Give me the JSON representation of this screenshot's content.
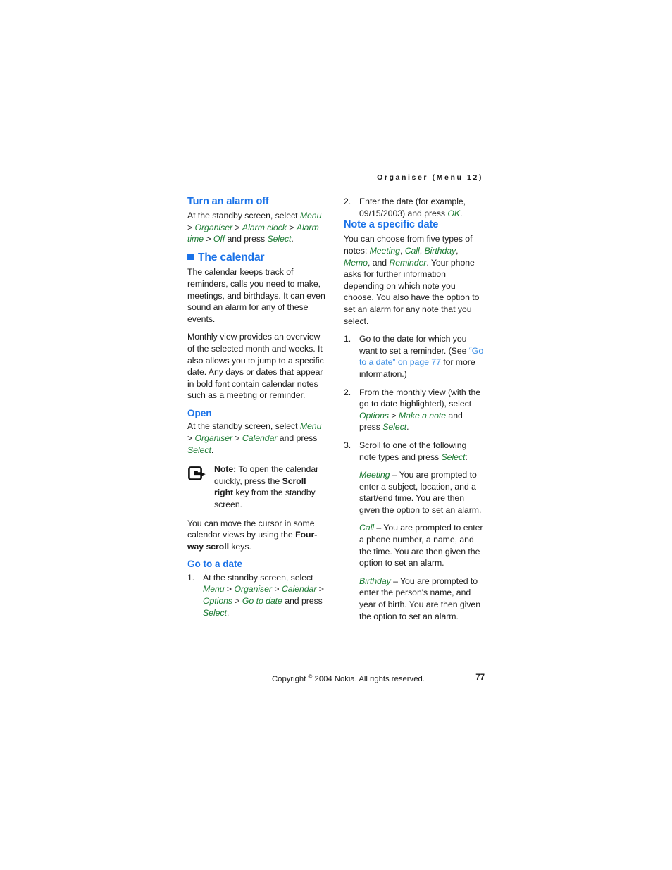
{
  "header": {
    "running_head": "Organiser (Menu 12)"
  },
  "left_column": {
    "turn_alarm_off": {
      "heading": "Turn an alarm off",
      "para_lead": "At the standby screen, select ",
      "path_menu": "Menu",
      "sep1": " > ",
      "path_organiser": "Organiser",
      "sep2": " > ",
      "path_alarm_clock": "Alarm clock",
      "sep3": " > ",
      "path_alarm_time": "Alarm time",
      "sep4": " > ",
      "path_off": "Off",
      "mid": " and press ",
      "path_select": "Select",
      "end": "."
    },
    "the_calendar": {
      "heading": "The calendar",
      "para1": "The calendar keeps track of reminders, calls you need to make, meetings, and birthdays. It can even sound an alarm for any of these events.",
      "para2": "Monthly view provides an overview of the selected month and weeks. It also allows you to jump to a specific date. Any days or dates that appear in bold font contain calendar notes such as a meeting or reminder."
    },
    "open": {
      "heading": "Open",
      "para_lead": "At the standby screen, select ",
      "path_menu": "Menu",
      "sep1": " > ",
      "path_organiser": "Organiser",
      "sep2": " > ",
      "path_calendar": "Calendar",
      "mid": " and press ",
      "path_select": "Select",
      "end": ".",
      "note_label": "Note:",
      "note_text_1": " To open the calendar quickly, press the ",
      "note_bold": "Scroll right",
      "note_text_2": " key from the standby screen.",
      "after_note_1": "You can move the cursor in some calendar views by using the ",
      "after_note_bold": "Four-way scroll",
      "after_note_2": " keys."
    },
    "go_to_a_date": {
      "heading": "Go to a date",
      "item1_num": "1.",
      "item1_lead": "At the standby screen, select ",
      "path_menu": "Menu",
      "sep1": " > ",
      "path_organiser": "Organiser",
      "sep2": " > ",
      "path_calendar": "Calendar",
      "sep3": " > ",
      "path_options": "Options",
      "sep4": " > ",
      "path_go_to_date": "Go to date",
      "mid": " and press ",
      "path_select": "Select",
      "end": "."
    }
  },
  "right_column": {
    "step2_continued": {
      "num": "2.",
      "lead": "Enter the date (for example, 09/15/2003) and press ",
      "path_ok": "OK",
      "end": "."
    },
    "note_specific_date": {
      "heading": "Note a specific date",
      "intro_lead": "You can choose from five types of notes: ",
      "type_meeting": "Meeting",
      "c1": ", ",
      "type_call": "Call",
      "c2": ", ",
      "type_birthday": "Birthday",
      "c3": ", ",
      "type_memo": "Memo",
      "c4": ", and ",
      "type_reminder": "Reminder",
      "intro_tail": ". Your phone asks for further information depending on which note you choose. You also have the option to set an alarm for any note that you select."
    },
    "steps": [
      {
        "num": "1.",
        "lead": "Go to the date for which you want to set a reminder. (See ",
        "xref": "“Go to a date” on page 77",
        "tail": " for more information.)"
      },
      {
        "num": "2.",
        "lead": "From the monthly view (with the go to date highlighted), select ",
        "path_options": "Options",
        "sep": " > ",
        "path_make_note": "Make a note",
        "mid": " and press ",
        "path_select": "Select",
        "tail": "."
      },
      {
        "num": "3.",
        "lead": "Scroll to one of the following note types and press ",
        "path_select": "Select",
        "tail": ":"
      }
    ],
    "note_types": [
      {
        "name": "Meeting",
        "dash": " – ",
        "description": "You are prompted to enter a subject, location, and a start/end time. You are then given the option to set an alarm."
      },
      {
        "name": "Call",
        "dash": " – ",
        "description": "You are prompted to enter a phone number, a name, and the time. You are then given the option to set an alarm."
      },
      {
        "name": "Birthday",
        "dash": " – ",
        "description": "You are prompted to enter the person's name, and year of birth. You are then given the option to set an alarm."
      }
    ]
  },
  "footer": {
    "copyright_pre": "Copyright ",
    "copyright_symbol": "©",
    "copyright_post": " 2004 Nokia. All rights reserved.",
    "page_number": "77"
  },
  "colors": {
    "heading_blue": "#1a72e8",
    "ui_green": "#1c7a33",
    "xref_blue": "#3a8ce2",
    "body_black": "#1c1c1c"
  }
}
